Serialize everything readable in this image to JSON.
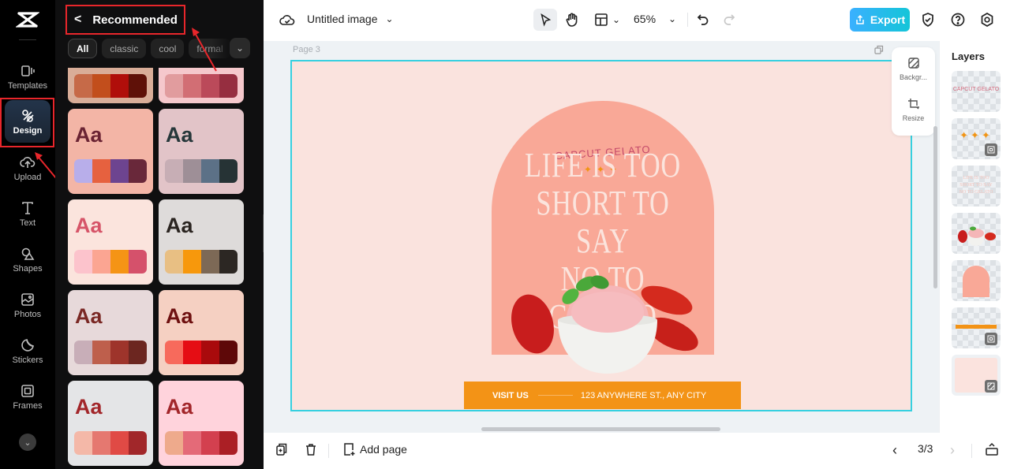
{
  "app": {
    "logo": "capcut-logo"
  },
  "rail": {
    "items": [
      {
        "label": "Templates",
        "icon": "templates-icon"
      },
      {
        "label": "Design",
        "icon": "design-icon",
        "active": true
      },
      {
        "label": "Upload",
        "icon": "upload-icon"
      },
      {
        "label": "Text",
        "icon": "text-icon"
      },
      {
        "label": "Shapes",
        "icon": "shapes-icon"
      },
      {
        "label": "Photos",
        "icon": "photos-icon"
      },
      {
        "label": "Stickers",
        "icon": "stickers-icon"
      },
      {
        "label": "Frames",
        "icon": "frames-icon"
      }
    ],
    "more_icon": "chevron-down-icon"
  },
  "panel": {
    "title": "Recommended",
    "back_icon": "chevron-left-icon",
    "chips": [
      {
        "label": "All",
        "active": true
      },
      {
        "label": "classic"
      },
      {
        "label": "cool"
      },
      {
        "label": "formal"
      }
    ],
    "cards": [
      {
        "aa": "",
        "bg": "#d9ad98",
        "text": "#6a2333",
        "palette": [
          "#c66a48",
          "#c24e1c",
          "#b00e0a",
          "#5f1108"
        ]
      },
      {
        "aa": "",
        "bg": "#f5c8cc",
        "text": "#6a2333",
        "palette": [
          "#e19c9e",
          "#d26e74",
          "#bb4a5a",
          "#962e40"
        ]
      },
      {
        "aa": "Aa",
        "bg": "#f3b5a6",
        "text": "#6a2333",
        "palette": [
          "#b8aeea",
          "#e6613f",
          "#6d4490",
          "#69283a"
        ]
      },
      {
        "aa": "Aa",
        "bg": "#e2c4c8",
        "text": "#26373a",
        "palette": [
          "#c7aeb5",
          "#9e8f97",
          "#5c7187",
          "#263335"
        ]
      },
      {
        "aa": "Aa",
        "bg": "#fbe4dd",
        "text": "#d65468",
        "palette": [
          "#fcc3cc",
          "#fba592",
          "#f59415",
          "#d5516b"
        ]
      },
      {
        "aa": "Aa",
        "bg": "#dedbda",
        "text": "#2a2420",
        "palette": [
          "#e8bf83",
          "#f7980c",
          "#7d6956",
          "#2c2723"
        ]
      },
      {
        "aa": "Aa",
        "bg": "#e7d9da",
        "text": "#7a2824",
        "palette": [
          "#c8aeb8",
          "#be5f4c",
          "#9e342b",
          "#6c2620"
        ]
      },
      {
        "aa": "Aa",
        "bg": "#f5d0c2",
        "text": "#6e1010",
        "palette": [
          "#f76a5c",
          "#e50d14",
          "#a90a0c",
          "#5e0808"
        ]
      },
      {
        "aa": "Aa",
        "bg": "#e4e5e7",
        "text": "#a2262a",
        "palette": [
          "#f4b8a8",
          "#e57870",
          "#e04a45",
          "#a1272a"
        ]
      },
      {
        "aa": "Aa",
        "bg": "#ffd3dc",
        "text": "#a2262a",
        "palette": [
          "#eeaa8c",
          "#e46a78",
          "#d3404f",
          "#ab1f25"
        ]
      }
    ]
  },
  "topbar": {
    "doc_title": "Untitled image",
    "zoom": "65%",
    "export_label": "Export"
  },
  "canvas": {
    "page_label": "Page 3",
    "brand": "CAPCUT GELATO",
    "stars": "✦✦✦",
    "headline": [
      "LIFE IS TOO",
      "SHORT TO SAY",
      "NO TO GELATO"
    ],
    "visit_label": "VISIT US",
    "address": "123 ANYWHERE ST., ANY CITY",
    "colors": {
      "background": "#fae3de",
      "arch": "#f9a897",
      "banner": "#f39316",
      "selection": "#36d0e0"
    }
  },
  "float_tools": [
    {
      "label": "Backgr...",
      "icon": "background-icon"
    },
    {
      "label": "Resize",
      "icon": "resize-icon"
    }
  ],
  "layers": {
    "title": "Layers",
    "items": [
      {
        "name": "brand-text-layer"
      },
      {
        "name": "stars-layer"
      },
      {
        "name": "headline-layer"
      },
      {
        "name": "gelato-photo-layer"
      },
      {
        "name": "arch-shape-layer"
      },
      {
        "name": "banner-layer"
      },
      {
        "name": "background-layer"
      }
    ]
  },
  "bottombar": {
    "add_page_label": "Add page",
    "page_counter": "3/3"
  }
}
